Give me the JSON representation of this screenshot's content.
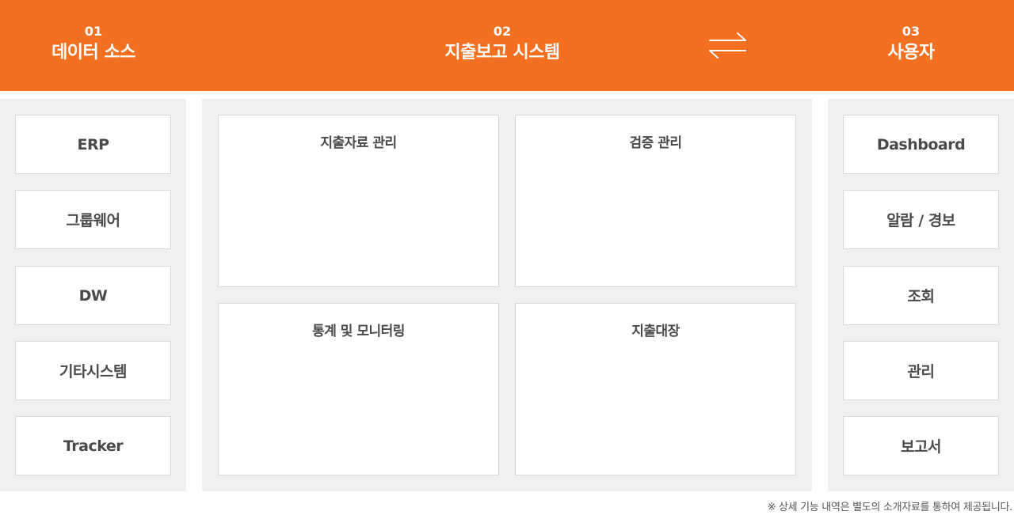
{
  "header": {
    "steps": [
      {
        "number": "01",
        "title": "데이터 소스"
      },
      {
        "number": "02",
        "title": "지출보고 시스템"
      },
      {
        "number": "03",
        "title": "사용자"
      }
    ],
    "exchange_icon": "bidirectional-arrows-icon"
  },
  "data_sources": [
    "ERP",
    "그룹웨어",
    "DW",
    "기타시스템",
    "Tracker"
  ],
  "system_panels": [
    "지출자료 관리",
    "검증 관리",
    "통계 및 모니터링",
    "지출대장"
  ],
  "user_features": [
    "Dashboard",
    "알람 / 경보",
    "조회",
    "관리",
    "보고서"
  ],
  "footnote": "※ 상세 기능 내역은 별도의 소개자료를 통하여 제공됩니다.",
  "colors": {
    "accent": "#f37021",
    "panel_bg": "#f0f0f0",
    "card_bg": "#ffffff",
    "border": "#d9d9d9"
  }
}
